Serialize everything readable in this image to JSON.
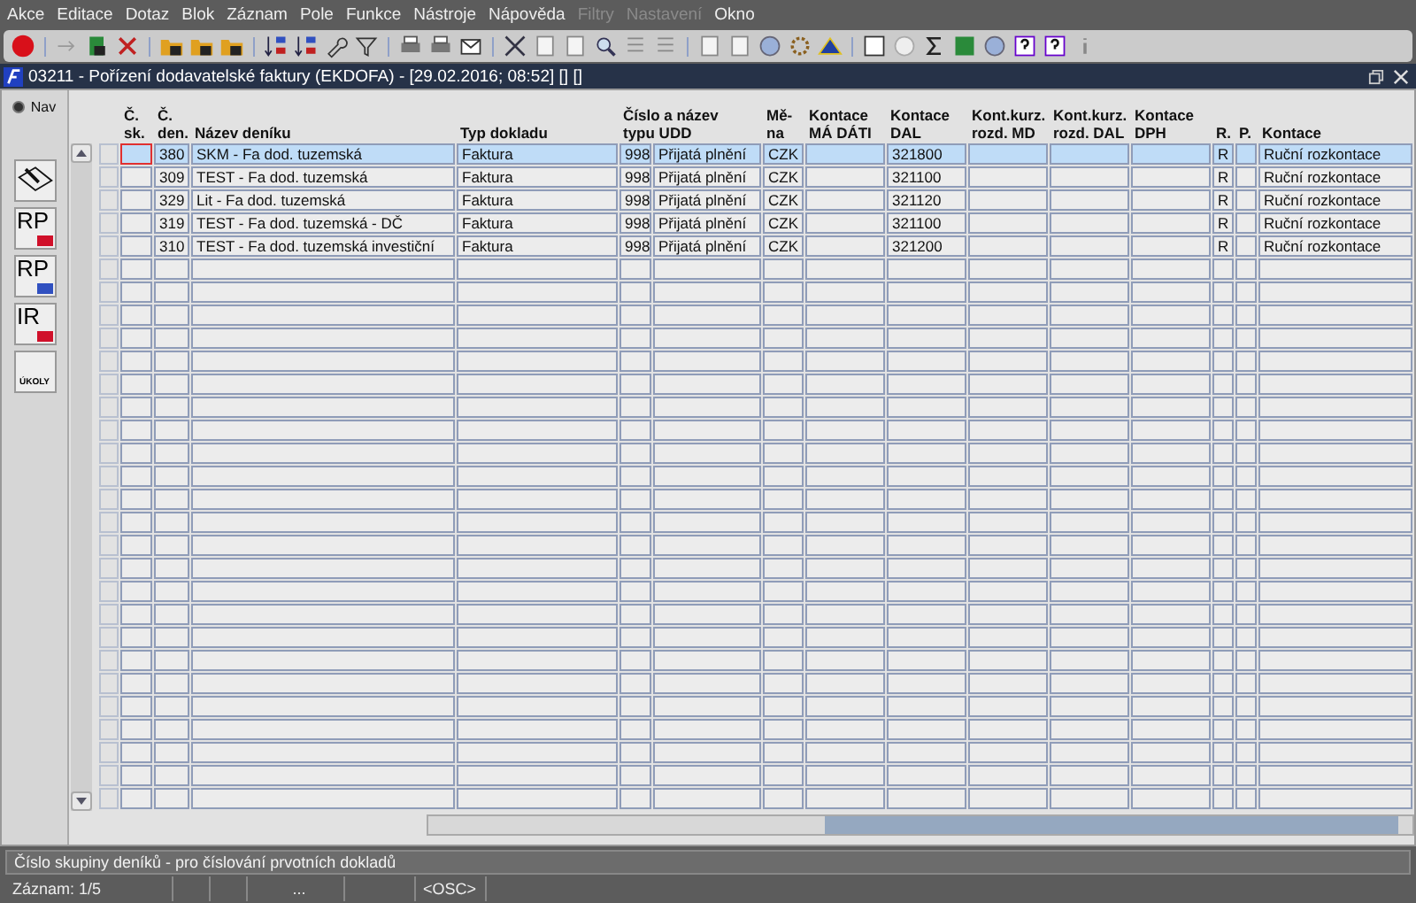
{
  "menu": [
    {
      "label": "Akce",
      "disabled": false
    },
    {
      "label": "Editace",
      "disabled": false
    },
    {
      "label": "Dotaz",
      "disabled": false
    },
    {
      "label": "Blok",
      "disabled": false
    },
    {
      "label": "Záznam",
      "disabled": false
    },
    {
      "label": "Pole",
      "disabled": false
    },
    {
      "label": "Funkce",
      "disabled": false
    },
    {
      "label": "Nástroje",
      "disabled": false
    },
    {
      "label": "Nápověda",
      "disabled": false
    },
    {
      "label": "Filtry",
      "disabled": true
    },
    {
      "label": "Nastavení",
      "disabled": true
    },
    {
      "label": "Okno",
      "disabled": false
    }
  ],
  "window": {
    "title": "03211 - Pořízení dodavatelské faktury (EKDOFA) - [29.02.2016; 08:52] [] []"
  },
  "nav": {
    "label": "Nav",
    "selected": true,
    "buttons": [
      {
        "kind": "icon"
      },
      {
        "kind": "text",
        "label": "RP",
        "color": "#d0102a"
      },
      {
        "kind": "text",
        "label": "RP",
        "color": "#3050c0"
      },
      {
        "kind": "text",
        "label": "IR",
        "color": "#d0102a"
      },
      {
        "kind": "tasks",
        "label": "ÚKOLY"
      }
    ]
  },
  "table": {
    "columns": [
      {
        "lines": [
          "Č.",
          "sk."
        ],
        "wide": false
      },
      {
        "lines": [
          "Č.",
          "den."
        ],
        "wide": false
      },
      {
        "lines": [
          "Název deníku"
        ],
        "wide": false
      },
      {
        "lines": [
          "Typ dokladu"
        ],
        "wide": false
      },
      {
        "lines": [
          "Číslo a název",
          "typu UDD"
        ],
        "wide": true
      },
      {
        "lines": [
          "Mě-",
          "na"
        ],
        "wide": false
      },
      {
        "lines": [
          "Kontace",
          "MÁ DÁTI"
        ],
        "wide": false
      },
      {
        "lines": [
          "Kontace",
          "DAL"
        ],
        "wide": false
      },
      {
        "lines": [
          "Kont.kurz.",
          "rozd. MD"
        ],
        "wide": false
      },
      {
        "lines": [
          "Kont.kurz.",
          "rozd. DAL"
        ],
        "wide": false
      },
      {
        "lines": [
          "Kontace",
          "DPH"
        ],
        "wide": false
      },
      {
        "lines": [
          "R."
        ],
        "wide": false
      },
      {
        "lines": [
          "P."
        ],
        "wide": false
      },
      {
        "lines": [
          "Kontace"
        ],
        "wide": false
      }
    ],
    "rows": [
      {
        "selected": true,
        "editing": true,
        "den": "380",
        "name": "SKM - Fa dod. tuzemská",
        "type": "Faktura",
        "type_no": "998",
        "udd": "Přijatá plnění",
        "currency": "CZK",
        "credit": "321800",
        "r": "R",
        "posting": "Ruční rozkontace"
      },
      {
        "selected": false,
        "editing": false,
        "den": "309",
        "name": "TEST - Fa dod. tuzemská",
        "type": "Faktura",
        "type_no": "998",
        "udd": "Přijatá plnění",
        "currency": "CZK",
        "credit": "321100",
        "r": "R",
        "posting": "Ruční rozkontace"
      },
      {
        "selected": false,
        "editing": false,
        "den": "329",
        "name": "Lit - Fa dod. tuzemská",
        "type": "Faktura",
        "type_no": "998",
        "udd": "Přijatá plnění",
        "currency": "CZK",
        "credit": "321120",
        "r": "R",
        "posting": "Ruční rozkontace"
      },
      {
        "selected": false,
        "editing": false,
        "den": "319",
        "name": "TEST - Fa dod. tuzemská - DČ",
        "type": "Faktura",
        "type_no": "998",
        "udd": "Přijatá plnění",
        "currency": "CZK",
        "credit": "321100",
        "r": "R",
        "posting": "Ruční rozkontace"
      },
      {
        "selected": false,
        "editing": false,
        "den": "310",
        "name": "TEST - Fa dod. tuzemská investiční",
        "type": "Faktura",
        "type_no": "998",
        "udd": "Přijatá plnění",
        "currency": "CZK",
        "credit": "321200",
        "r": "R",
        "posting": "Ruční rozkontace"
      }
    ]
  },
  "hint": "Číslo skupiny deníků - pro číslování prvotních dokladů",
  "status_bar": {
    "record": "Záznam: 1/5",
    "field_4": "...",
    "mode": "<OSC>"
  }
}
